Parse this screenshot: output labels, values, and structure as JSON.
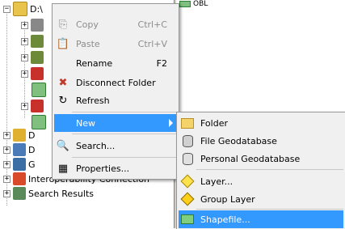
{
  "tree": {
    "root_label": "D:\\",
    "items": [
      {
        "label": "D"
      },
      {
        "label": "D"
      },
      {
        "label": "G"
      },
      {
        "label": "Interoperability Connection"
      },
      {
        "label": "Search Results"
      }
    ],
    "right_label": "OBL"
  },
  "context_menu": {
    "items": [
      {
        "label": "Copy",
        "shortcut": "Ctrl+C",
        "icon": "copy-icon",
        "disabled": true
      },
      {
        "label": "Paste",
        "shortcut": "Ctrl+V",
        "icon": "paste-icon",
        "disabled": true
      },
      {
        "label": "Rename",
        "shortcut": "F2",
        "icon": "",
        "disabled": false
      },
      {
        "label": "Disconnect Folder",
        "shortcut": "",
        "icon": "disconnect-icon",
        "disabled": false
      },
      {
        "label": "Refresh",
        "shortcut": "",
        "icon": "refresh-icon",
        "disabled": false
      },
      {
        "label": "New",
        "shortcut": "",
        "icon": "",
        "disabled": false,
        "highlighted": true,
        "submenu": true
      },
      {
        "label": "Search...",
        "shortcut": "",
        "icon": "search-icon",
        "disabled": false
      },
      {
        "label": "Properties...",
        "shortcut": "",
        "icon": "properties-icon",
        "disabled": false
      }
    ]
  },
  "new_submenu": {
    "items": [
      {
        "label": "Folder",
        "icon": "folder-icon"
      },
      {
        "label": "File Geodatabase",
        "icon": "file-geodatabase-icon"
      },
      {
        "label": "Personal Geodatabase",
        "icon": "personal-geodatabase-icon"
      },
      {
        "label": "Layer...",
        "icon": "layer-icon"
      },
      {
        "label": "Group Layer",
        "icon": "group-layer-icon"
      },
      {
        "label": "Shapefile...",
        "icon": "shapefile-icon",
        "highlighted": true
      }
    ]
  },
  "colors": {
    "highlight": "#3399ff",
    "menu_bg": "#f0f0f0"
  }
}
